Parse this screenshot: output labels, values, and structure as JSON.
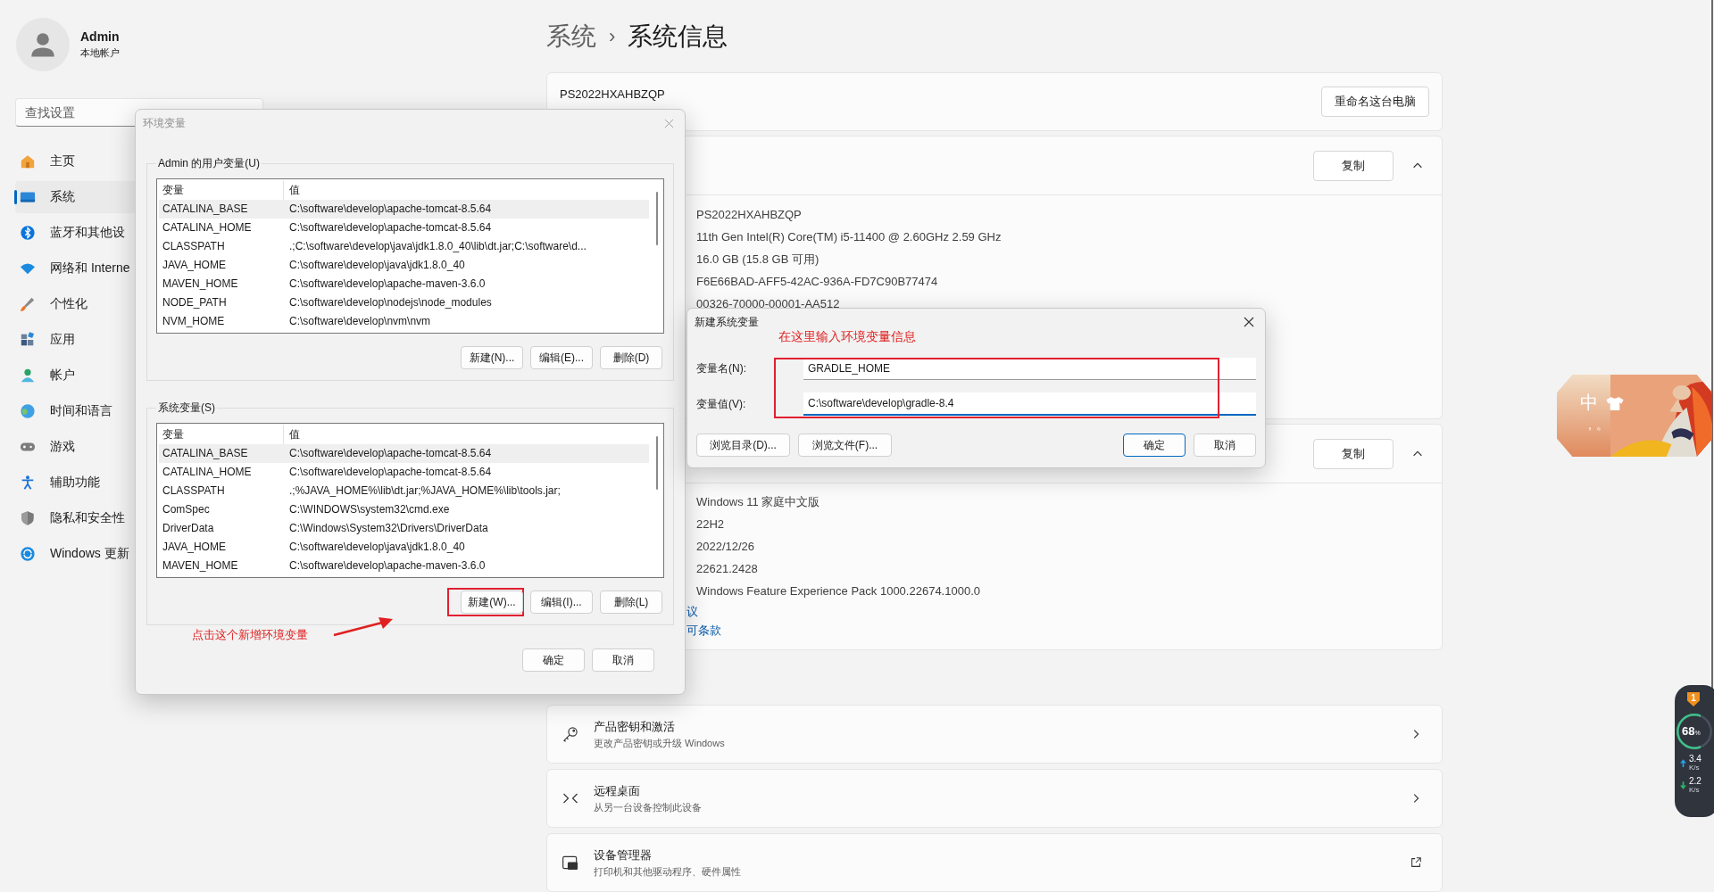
{
  "account": {
    "name": "Admin",
    "type": "本地帐户"
  },
  "search": {
    "placeholder": "查找设置"
  },
  "sidebar": {
    "items": [
      {
        "label": "主页",
        "kind": "home",
        "selected": false
      },
      {
        "label": "系统",
        "kind": "system",
        "selected": true
      },
      {
        "label": "蓝牙和其他设",
        "kind": "bluetooth",
        "selected": false
      },
      {
        "label": "网络和 Interne",
        "kind": "wifi",
        "selected": false
      },
      {
        "label": "个性化",
        "kind": "brush",
        "selected": false
      },
      {
        "label": "应用",
        "kind": "apps",
        "selected": false
      },
      {
        "label": "帐户",
        "kind": "account",
        "selected": false
      },
      {
        "label": "时间和语言",
        "kind": "globe",
        "selected": false
      },
      {
        "label": "游戏",
        "kind": "game",
        "selected": false
      },
      {
        "label": "辅助功能",
        "kind": "accessibility",
        "selected": false
      },
      {
        "label": "隐私和安全性",
        "kind": "shield",
        "selected": false
      },
      {
        "label": "Windows 更新",
        "kind": "update",
        "selected": false
      }
    ]
  },
  "breadcrumb": {
    "parent": "系统",
    "separator": "›",
    "current": "系统信息"
  },
  "device_card": {
    "name": "PS2022HXAHBZQP",
    "button": "重命名这台电脑"
  },
  "device_specs": {
    "copy_button": "复制",
    "expanded": true,
    "values": [
      "PS2022HXAHBZQP",
      "11th Gen Intel(R) Core(TM) i5-11400 @ 2.60GHz   2.59 GHz",
      "16.0 GB (15.8 GB 可用)",
      "F6E66BAD-AFF5-42AC-936A-FD7C90B77474",
      "00326-70000-00001-AA512"
    ]
  },
  "windows_specs": {
    "copy_button": "复制",
    "expanded": true,
    "values": [
      "Windows 11 家庭中文版",
      "22H2",
      "2022/12/26",
      "22621.2428",
      "Windows Feature Experience Pack 1000.22674.1000.0"
    ],
    "links": [
      "议",
      "可条款"
    ]
  },
  "related": [
    {
      "title": "产品密钥和激活",
      "subtitle": "更改产品密钥或升级 Windows",
      "kind": "key"
    },
    {
      "title": "远程桌面",
      "subtitle": "从另一台设备控制此设备",
      "kind": "remote"
    },
    {
      "title": "设备管理器",
      "subtitle": "打印机和其他驱动程序、硬件属性",
      "kind": "device"
    }
  ],
  "env_dialog": {
    "title": "环境变量",
    "active": false,
    "user_group": {
      "label": "Admin 的用户变量(U)",
      "columns": [
        "变量",
        "值"
      ],
      "rows": [
        {
          "name": "CATALINA_BASE",
          "value": "C:\\software\\develop\\apache-tomcat-8.5.64",
          "selected": true
        },
        {
          "name": "CATALINA_HOME",
          "value": "C:\\software\\develop\\apache-tomcat-8.5.64",
          "selected": false
        },
        {
          "name": "CLASSPATH",
          "value": ".;C:\\software\\develop\\java\\jdk1.8.0_40\\lib\\dt.jar;C:\\software\\d...",
          "selected": false
        },
        {
          "name": "JAVA_HOME",
          "value": "C:\\software\\develop\\java\\jdk1.8.0_40",
          "selected": false
        },
        {
          "name": "MAVEN_HOME",
          "value": "C:\\software\\develop\\apache-maven-3.6.0",
          "selected": false
        },
        {
          "name": "NODE_PATH",
          "value": "C:\\software\\develop\\nodejs\\node_modules",
          "selected": false
        },
        {
          "name": "NVM_HOME",
          "value": "C:\\software\\develop\\nvm\\nvm",
          "selected": false
        }
      ],
      "buttons": [
        {
          "label": "新建(N)...",
          "highlighted": false
        },
        {
          "label": "编辑(E)...",
          "highlighted": false
        },
        {
          "label": "删除(D)",
          "highlighted": false
        }
      ]
    },
    "system_group": {
      "label": "系统变量(S)",
      "columns": [
        "变量",
        "值"
      ],
      "rows": [
        {
          "name": "CATALINA_BASE",
          "value": "C:\\software\\develop\\apache-tomcat-8.5.64",
          "selected": true
        },
        {
          "name": "CATALINA_HOME",
          "value": "C:\\software\\develop\\apache-tomcat-8.5.64",
          "selected": false
        },
        {
          "name": "CLASSPATH",
          "value": ".;%JAVA_HOME%\\lib\\dt.jar;%JAVA_HOME%\\lib\\tools.jar;",
          "selected": false
        },
        {
          "name": "ComSpec",
          "value": "C:\\WINDOWS\\system32\\cmd.exe",
          "selected": false
        },
        {
          "name": "DriverData",
          "value": "C:\\Windows\\System32\\Drivers\\DriverData",
          "selected": false
        },
        {
          "name": "JAVA_HOME",
          "value": "C:\\software\\develop\\java\\jdk1.8.0_40",
          "selected": false
        },
        {
          "name": "MAVEN_HOME",
          "value": "C:\\software\\develop\\apache-maven-3.6.0",
          "selected": false
        }
      ],
      "buttons": [
        {
          "label": "新建(W)...",
          "highlighted": true
        },
        {
          "label": "编辑(I)...",
          "highlighted": false
        },
        {
          "label": "删除(L)",
          "highlighted": false
        }
      ]
    },
    "annotation": "点击这个新增环境变量",
    "buttons": [
      "确定",
      "取消"
    ]
  },
  "new_var_dialog": {
    "title": "新建系统变量",
    "active": true,
    "annotation": "在这里输入环境变量信息",
    "fields": [
      {
        "label": "变量名(N):",
        "value": "GRADLE_HOME",
        "focused": false
      },
      {
        "label": "变量值(V):",
        "value": "C:\\software\\develop\\gradle-8.4",
        "focused": true
      }
    ],
    "buttons": [
      {
        "label": "浏览目录(D)...",
        "default": false
      },
      {
        "label": "浏览文件(F)...",
        "default": false
      },
      {
        "label": "确定",
        "default": true
      },
      {
        "label": "取消",
        "default": false
      }
    ]
  },
  "ime_widget": {
    "mode": "中",
    "punctuation": "，。"
  },
  "monitor": {
    "badge": "1",
    "level": 0.68,
    "reading": "68",
    "unit": "%",
    "upload": {
      "value": "3.4",
      "unit": "K/s"
    },
    "download": {
      "value": "2.2",
      "unit": "K/s"
    }
  }
}
